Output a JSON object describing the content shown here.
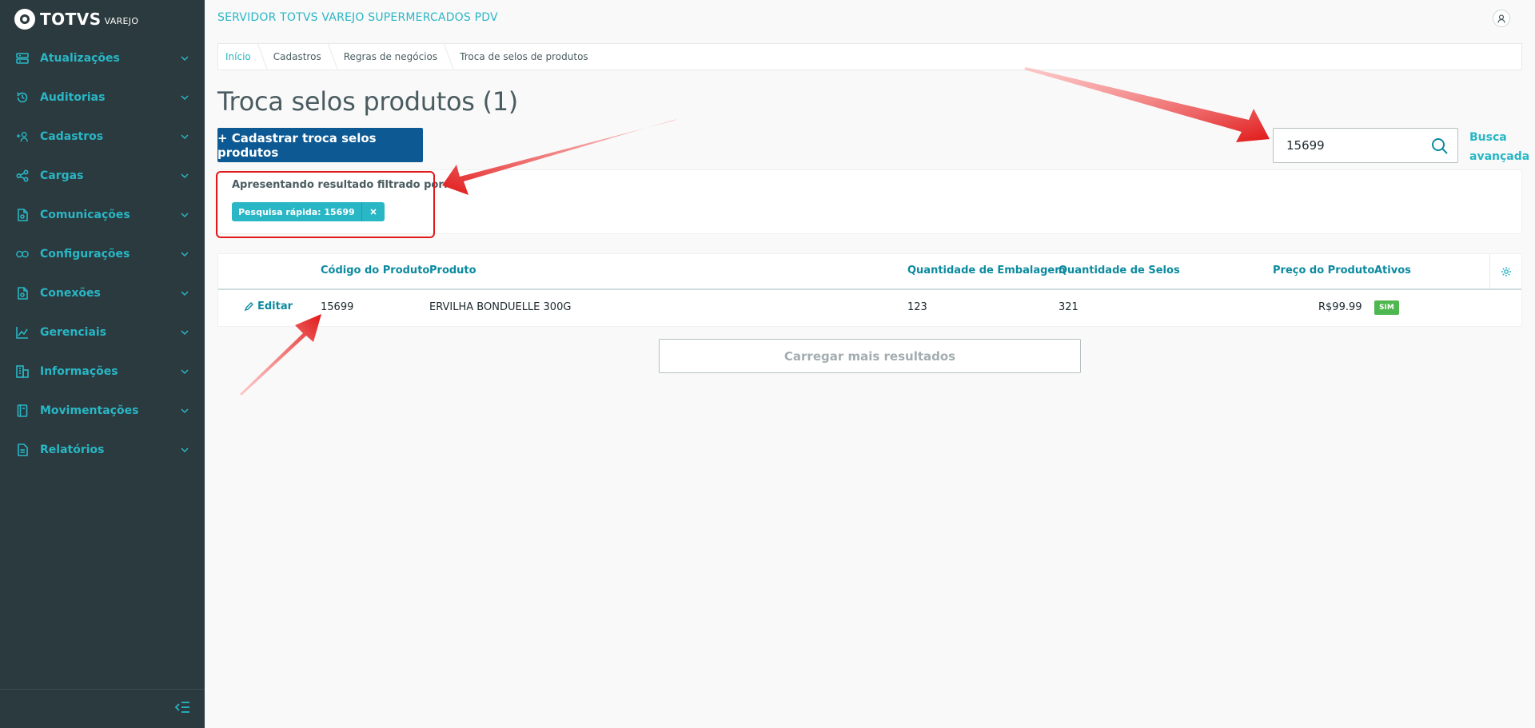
{
  "brand": {
    "name": "TOTVS",
    "sub": "VAREJO"
  },
  "header": {
    "server_title": "SERVIDOR TOTVS VAREJO SUPERMERCADOS PDV"
  },
  "sidebar": {
    "items": [
      {
        "label": "Atualizações",
        "icon": "server-icon"
      },
      {
        "label": "Auditorias",
        "icon": "history-icon"
      },
      {
        "label": "Cadastros",
        "icon": "user-add-icon"
      },
      {
        "label": "Cargas",
        "icon": "share-icon"
      },
      {
        "label": "Comunicações",
        "icon": "document-icon"
      },
      {
        "label": "Configurações",
        "icon": "link-icon"
      },
      {
        "label": "Conexões",
        "icon": "document-icon"
      },
      {
        "label": "Gerenciais",
        "icon": "chart-icon"
      },
      {
        "label": "Informações",
        "icon": "building-icon"
      },
      {
        "label": "Movimentações",
        "icon": "book-icon"
      },
      {
        "label": "Relatórios",
        "icon": "report-icon"
      }
    ]
  },
  "breadcrumb": [
    "Início",
    "Cadastros",
    "Regras de negócios",
    "Troca de selos de produtos"
  ],
  "page": {
    "title": "Troca selos produtos (1)",
    "primary_button": "+  Cadastrar troca selos produtos"
  },
  "search": {
    "value": "15699",
    "advanced_line1": "Busca",
    "advanced_line2": "avançada"
  },
  "filter": {
    "label": "Apresentando resultado filtrado por:",
    "chip": "Pesquisa rápida: 15699"
  },
  "table": {
    "columns": [
      "Código do Produto",
      "Produto",
      "Quantidade de Embalagem",
      "Quantidade de Selos",
      "Preço do Produto",
      "Ativos"
    ],
    "rows": [
      {
        "action": "Editar",
        "code": "15699",
        "product": "ERVILHA BONDUELLE 300G",
        "pack_qty": "123",
        "seal_qty": "321",
        "price": "R$99.99",
        "active": "SIM"
      }
    ]
  },
  "load_more": "Carregar mais resultados",
  "colors": {
    "sidebar_bg": "#2b3a3e",
    "accent": "#29b6c5",
    "primary": "#0c5993",
    "success": "#4fb74f",
    "annotation": "#e01818"
  }
}
